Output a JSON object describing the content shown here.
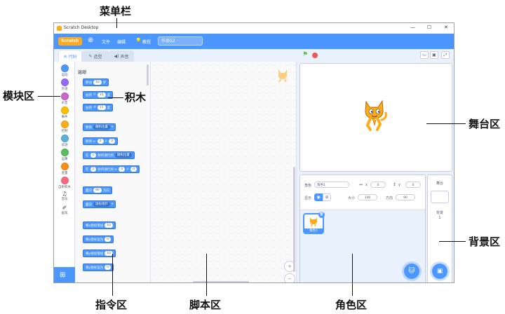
{
  "window": {
    "title": "Scratch Desktop",
    "controls": [
      "—",
      "☐",
      "✕"
    ]
  },
  "menubar": {
    "logo": "Scratch",
    "globe": "⊕",
    "file": "文件",
    "edit": "编辑",
    "tutorials": "教程",
    "project_title": "作品52"
  },
  "tabs": {
    "code": "代码",
    "costumes": "造型",
    "sounds": "声音"
  },
  "categories": [
    {
      "label": "运动",
      "color": "#4c97ff"
    },
    {
      "label": "外观",
      "color": "#9966ff"
    },
    {
      "label": "声音",
      "color": "#cf63cf"
    },
    {
      "label": "事件",
      "color": "#ffbf00"
    },
    {
      "label": "控制",
      "color": "#ffab19"
    },
    {
      "label": "侦测",
      "color": "#5cb1d6"
    },
    {
      "label": "运算",
      "color": "#59c059"
    },
    {
      "label": "变量",
      "color": "#ff8c1a"
    },
    {
      "label": "自制积木",
      "color": "#ff6680"
    },
    {
      "label": "音乐",
      "color": "#0fbd8c"
    },
    {
      "label": "画笔",
      "color": "#0fbd8c"
    }
  ],
  "palette": {
    "section": "运动",
    "blocks": {
      "move": {
        "a": "移动",
        "v": "10",
        "b": "步"
      },
      "turn_right": {
        "a": "右转",
        "v": "15",
        "b": "度"
      },
      "turn_left": {
        "a": "左转",
        "v": "15",
        "b": "度"
      },
      "goto": {
        "a": "移到",
        "dd": "随机位置"
      },
      "goto_xy": {
        "a": "移到 x:",
        "x": "0",
        "b": "y:",
        "y": "0"
      },
      "glide_to": {
        "a": "在",
        "v": "1",
        "b": "秒内滑行到",
        "dd": "随机位置"
      },
      "glide_xy": {
        "a": "在",
        "v": "1",
        "b": "秒内滑行到 x:",
        "x": "0",
        "c": "y:",
        "y": "0"
      },
      "point_dir": {
        "a": "面向",
        "v": "90",
        "b": "方向"
      },
      "point_to": {
        "a": "面向",
        "dd": "鼠标指针"
      },
      "change_x": {
        "a": "将x坐标增加",
        "v": "10"
      },
      "set_x": {
        "a": "将x坐标设为",
        "v": "0"
      },
      "change_y": {
        "a": "将y坐标增加",
        "v": "10"
      },
      "set_y": {
        "a": "将y坐标设为",
        "v": "0"
      }
    }
  },
  "zoom": {
    "in": "+",
    "out": "−",
    "reset": "="
  },
  "sprite_info": {
    "sprite_label": "角色",
    "sprite_name": "角色1",
    "x_label": "x",
    "x": "0",
    "y_label": "y",
    "y": "0",
    "show_label": "显示",
    "size_label": "大小",
    "size": "100",
    "dir_label": "方向",
    "dir": "90"
  },
  "sprite_list": {
    "sprite1": "角色1"
  },
  "backdrop": {
    "title": "舞台",
    "count_label": "背景",
    "count": "1"
  },
  "annotations": {
    "menubar": "菜单栏",
    "blocks_area": "模块区",
    "blocks": "积木",
    "stage": "舞台区",
    "backdrop": "背景区",
    "palette": "指令区",
    "script": "脚本区",
    "sprite": "角色区"
  }
}
